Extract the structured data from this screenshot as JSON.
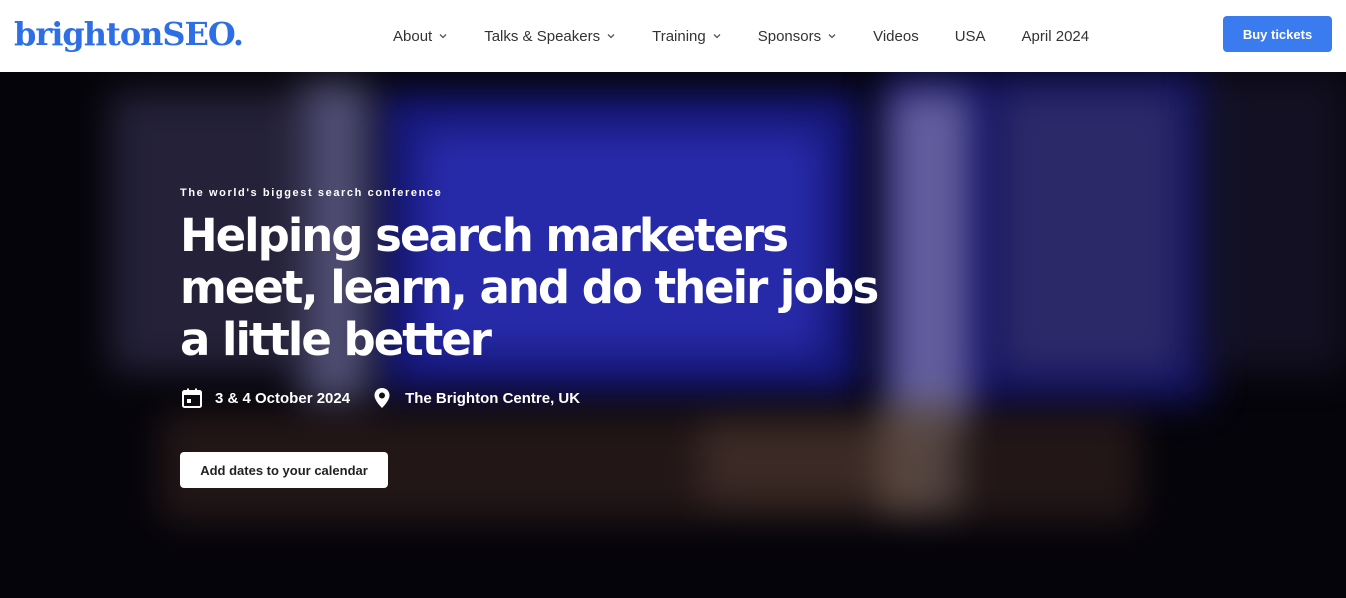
{
  "header": {
    "logo": "brightonSEO.",
    "nav": [
      {
        "label": "About",
        "dropdown": true
      },
      {
        "label": "Talks & Speakers",
        "dropdown": true
      },
      {
        "label": "Training",
        "dropdown": true
      },
      {
        "label": "Sponsors",
        "dropdown": true
      },
      {
        "label": "Videos",
        "dropdown": false
      },
      {
        "label": "USA",
        "dropdown": false
      },
      {
        "label": "April 2024",
        "dropdown": false
      }
    ],
    "cta": "Buy tickets"
  },
  "hero": {
    "eyebrow": "The world's biggest search conference",
    "headline": [
      "Helping search marketers",
      "meet, learn, and do their jobs",
      "a little better"
    ],
    "date": "3 & 4 October 2024",
    "location": "The Brighton Centre, UK",
    "calendar_button": "Add dates to your calendar",
    "icons": {
      "date": "calendar-icon",
      "location": "map-pin-icon"
    }
  },
  "colors": {
    "brand": "#2f6fe6",
    "button": "#3a7bf0",
    "hero_bg": "#05040a"
  }
}
